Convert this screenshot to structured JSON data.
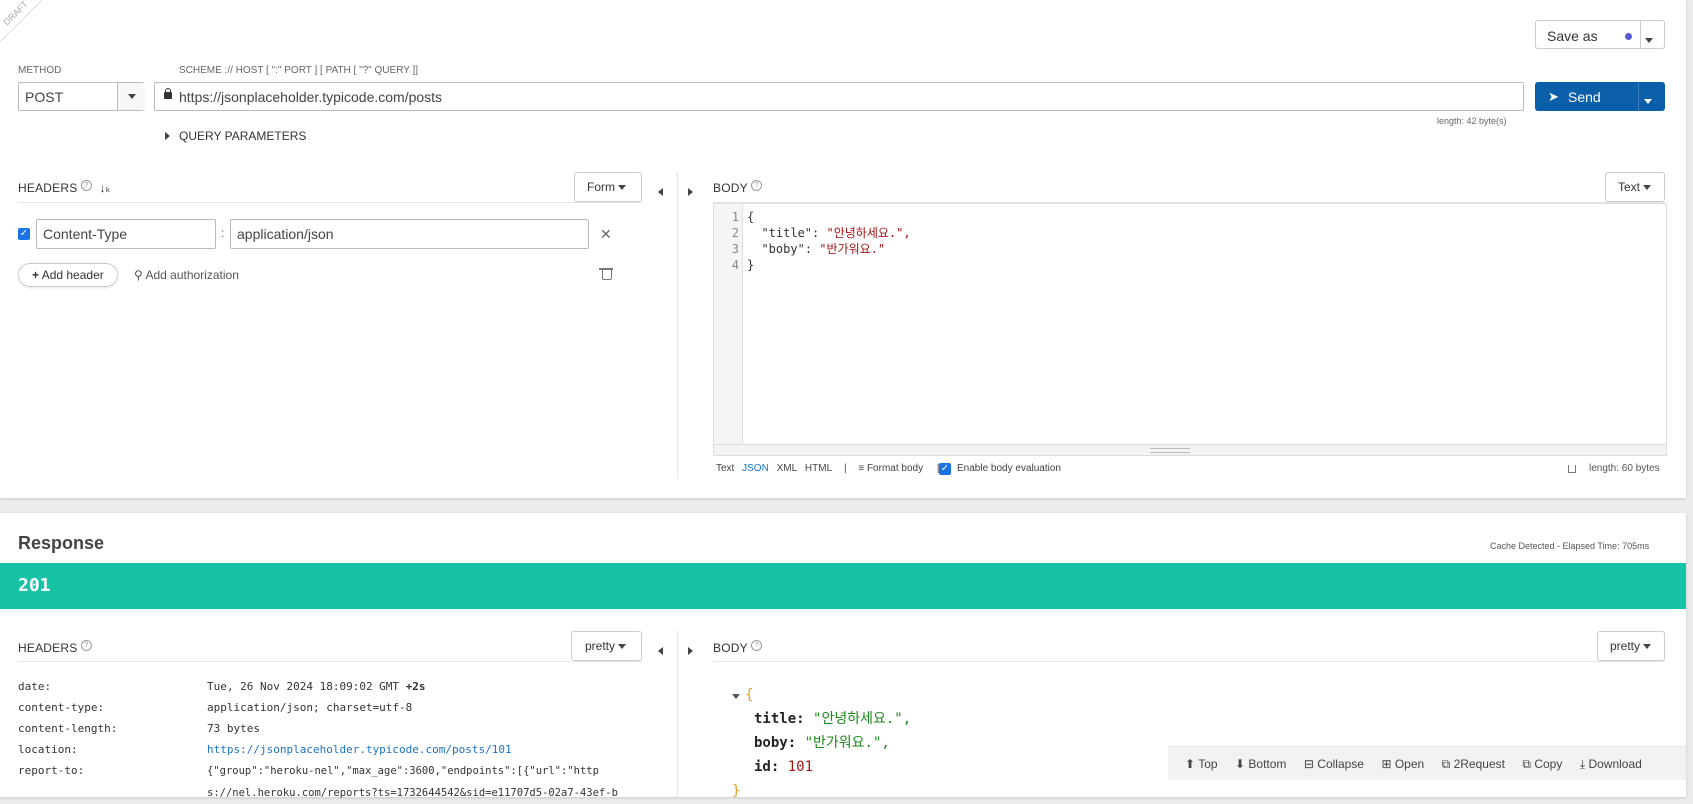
{
  "request": {
    "draft_label": "DRAFT",
    "save_as_label": "Save as",
    "method_label": "METHOD",
    "method_value": "POST",
    "url_label": "SCHEME :// HOST [ \":\" PORT ] [ PATH [ \"?\" QUERY ]]",
    "url_value": "https://jsonplaceholder.typicode.com/posts",
    "send_label": "Send",
    "url_length": "length: 42 byte(s)",
    "query_params_label": "QUERY PARAMETERS",
    "headers_title": "HEADERS",
    "headers_mode": "Form",
    "header_key": "Content-Type",
    "header_value": "application/json",
    "add_header_label": "Add header",
    "add_auth_label": "Add authorization",
    "body_title": "BODY",
    "body_mode": "Text",
    "body_lines": [
      {
        "num": "1",
        "text": "{"
      },
      {
        "num": "2",
        "key": "\"title\"",
        "val": "\"안녕하세요.\","
      },
      {
        "num": "3",
        "key": "\"boby\"",
        "val": "\"반가워요.\""
      },
      {
        "num": "4",
        "text": "}"
      }
    ],
    "body_formats": [
      "Text",
      "JSON",
      "XML",
      "HTML"
    ],
    "body_format_active": "JSON",
    "format_body_label": "Format body",
    "enable_eval_label": "Enable body evaluation",
    "body_length": "length: 60 bytes"
  },
  "response": {
    "title": "Response",
    "cache_info": "Cache Detected - Elapsed Time: 705ms",
    "status": "201",
    "status_color": "#17c3a6",
    "headers_title": "HEADERS",
    "headers_mode": "pretty",
    "body_title": "BODY",
    "body_mode": "pretty",
    "headers": [
      {
        "name": "date:",
        "value": "Tue, 26 Nov 2024 18:09:02 GMT",
        "extra": "+2s"
      },
      {
        "name": "content-type:",
        "value": "application/json; charset=utf-8"
      },
      {
        "name": "content-length:",
        "value": "73 bytes"
      },
      {
        "name": "location:",
        "value": "https://jsonplaceholder.typicode.com/posts/101"
      },
      {
        "name": "report-to:",
        "value": "{\"group\":\"heroku-nel\",\"max_age\":3600,\"endpoints\":[{\"url\":\"http",
        "value2": "s://nel.heroku.com/reports?ts=1732644542&sid=e11707d5-02a7-43ef-b"
      }
    ],
    "json_open": "{",
    "json_close": "}",
    "json_fields": [
      {
        "key": "title:",
        "val": "\"안녕하세요.\","
      },
      {
        "key": "boby:",
        "val": "\"반가워요.\","
      },
      {
        "key": "id:",
        "val": "101"
      }
    ],
    "toolbar": {
      "top": "Top",
      "bottom": "Bottom",
      "collapse": "Collapse",
      "open": "Open",
      "to_request": "2Request",
      "copy": "Copy",
      "download": "Download"
    }
  },
  "colors": {
    "send_button": "#0b5ea8",
    "accent_link": "#1a73c9",
    "string_red": "#a31515",
    "json_string_green": "#1b8a1b",
    "json_number": "#a31515"
  }
}
